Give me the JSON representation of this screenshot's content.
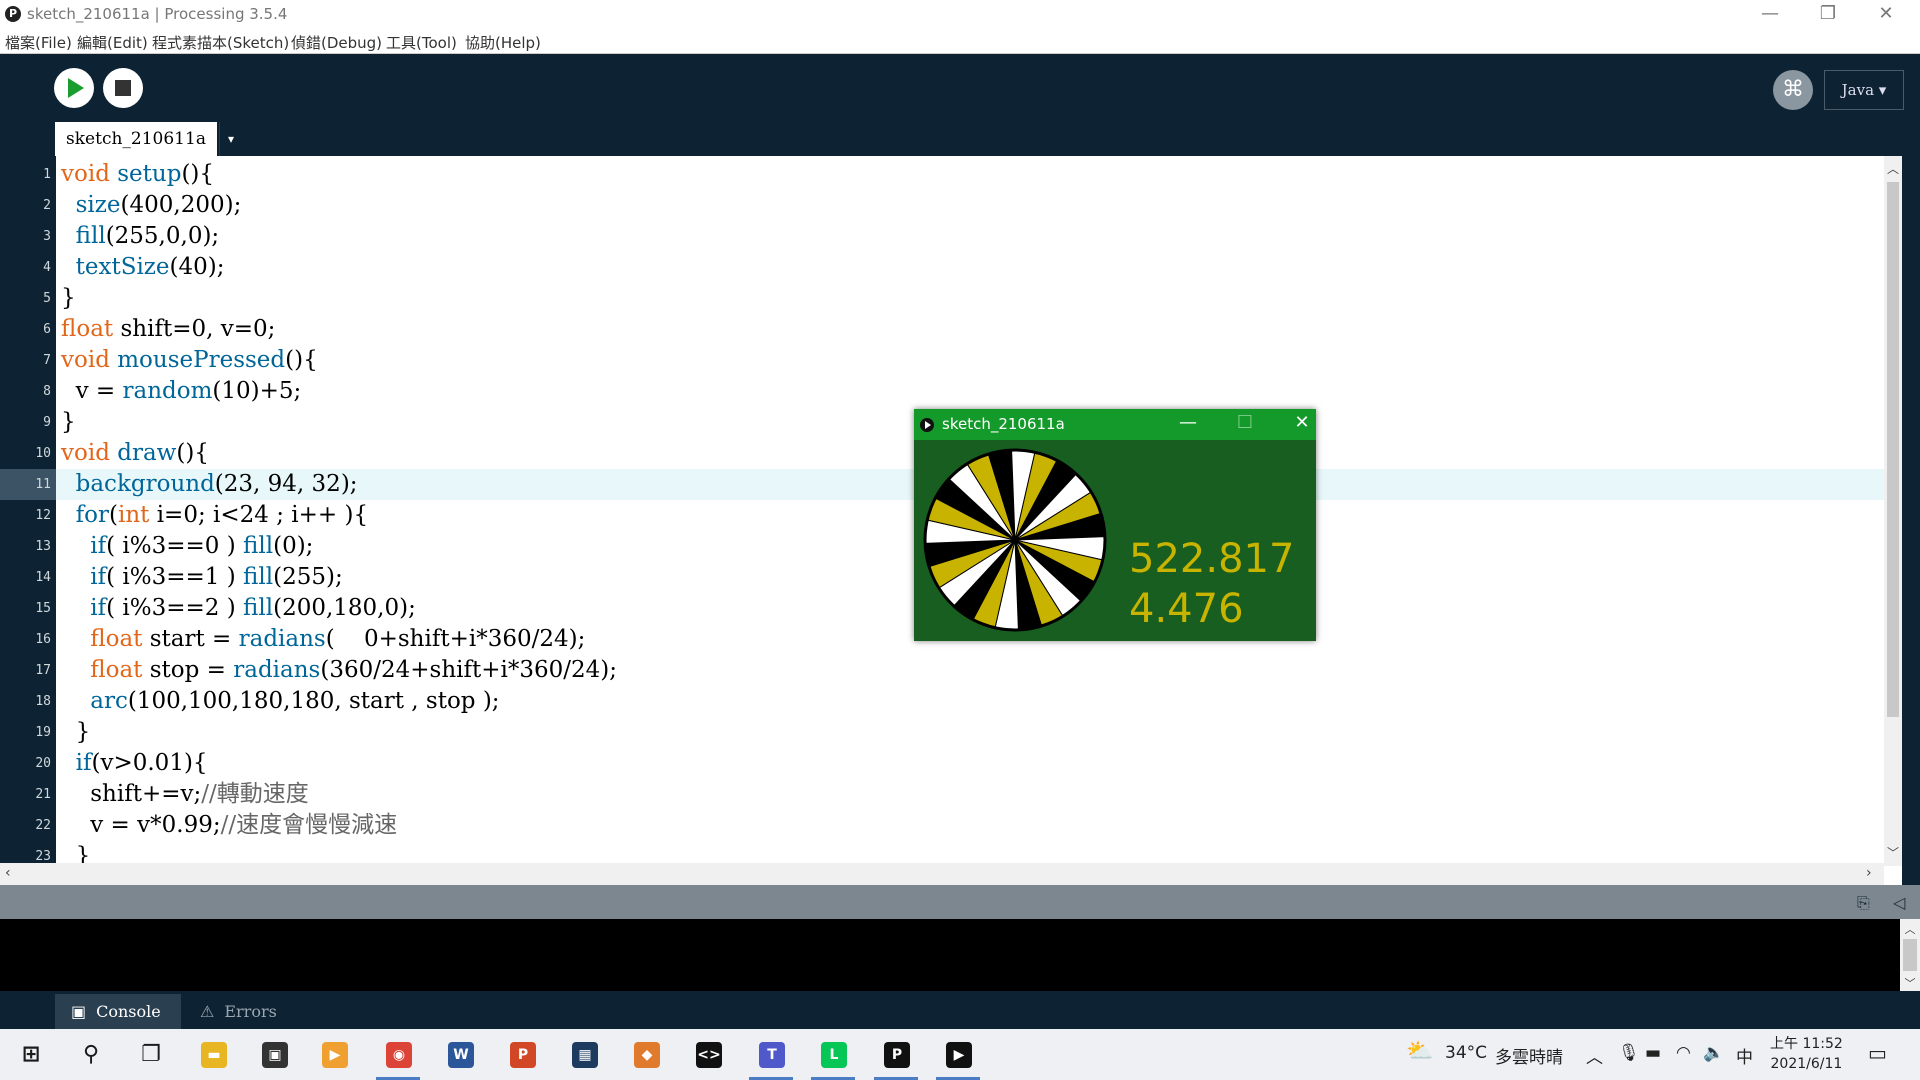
{
  "window": {
    "title": "sketch_210611a | Processing 3.5.4",
    "app_icon_glyph": "P",
    "controls": [
      "minimize-icon",
      "restore-icon",
      "close-icon"
    ]
  },
  "menu": {
    "items": [
      "檔案(File)",
      "編輯(Edit)",
      "程式素描本(Sketch)",
      "偵錯(Debug)",
      "工具(Tool)",
      "協助(Help)"
    ]
  },
  "toolbar": {
    "run_icon": "play-icon",
    "stop_icon": "stop-icon",
    "debugger_icon": "butterfly-icon",
    "mode_label": "Java ▾"
  },
  "tab": {
    "name": "sketch_210611a",
    "menu_arrow": "▾"
  },
  "editor": {
    "current_line": 11,
    "line_numbers": [
      "1",
      "2",
      "3",
      "4",
      "5",
      "6",
      "7",
      "8",
      "9",
      "10",
      "11",
      "12",
      "13",
      "14",
      "15",
      "16",
      "17",
      "18",
      "19",
      "20",
      "21",
      "22",
      "23"
    ],
    "lines": [
      [
        {
          "t": "void",
          "c": "kw"
        },
        {
          "t": " "
        },
        {
          "t": "setup",
          "c": "fn"
        },
        {
          "t": "(){"
        }
      ],
      [
        {
          "t": "  "
        },
        {
          "t": "size",
          "c": "fn"
        },
        {
          "t": "(400,200);"
        }
      ],
      [
        {
          "t": "  "
        },
        {
          "t": "fill",
          "c": "fn"
        },
        {
          "t": "(255,0,0);"
        }
      ],
      [
        {
          "t": "  "
        },
        {
          "t": "textSize",
          "c": "fn"
        },
        {
          "t": "(40);"
        }
      ],
      [
        {
          "t": "}"
        }
      ],
      [
        {
          "t": "float",
          "c": "kw"
        },
        {
          "t": " shift=0, v=0;"
        }
      ],
      [
        {
          "t": "void",
          "c": "kw"
        },
        {
          "t": " "
        },
        {
          "t": "mousePressed",
          "c": "fn"
        },
        {
          "t": "(){"
        }
      ],
      [
        {
          "t": "  v = "
        },
        {
          "t": "random",
          "c": "fn"
        },
        {
          "t": "(10)+5;"
        }
      ],
      [
        {
          "t": "}"
        }
      ],
      [
        {
          "t": "void",
          "c": "kw"
        },
        {
          "t": " "
        },
        {
          "t": "draw",
          "c": "fn"
        },
        {
          "t": "(){"
        }
      ],
      [
        {
          "t": "  "
        },
        {
          "t": "background",
          "c": "fn"
        },
        {
          "t": "(23, 94, 32);"
        }
      ],
      [
        {
          "t": "  "
        },
        {
          "t": "for",
          "c": "fn"
        },
        {
          "t": "("
        },
        {
          "t": "int",
          "c": "kw"
        },
        {
          "t": " i=0; i<24 ; i++ ){"
        }
      ],
      [
        {
          "t": "    "
        },
        {
          "t": "if",
          "c": "fn"
        },
        {
          "t": "( i%3==0 ) "
        },
        {
          "t": "fill",
          "c": "fn"
        },
        {
          "t": "(0);"
        }
      ],
      [
        {
          "t": "    "
        },
        {
          "t": "if",
          "c": "fn"
        },
        {
          "t": "( i%3==1 ) "
        },
        {
          "t": "fill",
          "c": "fn"
        },
        {
          "t": "(255);"
        }
      ],
      [
        {
          "t": "    "
        },
        {
          "t": "if",
          "c": "fn"
        },
        {
          "t": "( i%3==2 ) "
        },
        {
          "t": "fill",
          "c": "fn"
        },
        {
          "t": "(200,180,0);"
        }
      ],
      [
        {
          "t": "    "
        },
        {
          "t": "float",
          "c": "kw"
        },
        {
          "t": " start = "
        },
        {
          "t": "radians",
          "c": "fn"
        },
        {
          "t": "(    0+shift+i*360/24);"
        }
      ],
      [
        {
          "t": "    "
        },
        {
          "t": "float",
          "c": "kw"
        },
        {
          "t": " stop = "
        },
        {
          "t": "radians",
          "c": "fn"
        },
        {
          "t": "(360/24+shift+i*360/24);"
        }
      ],
      [
        {
          "t": "    "
        },
        {
          "t": "arc",
          "c": "fn"
        },
        {
          "t": "(100,100,180,180, start , stop );"
        }
      ],
      [
        {
          "t": "  }"
        }
      ],
      [
        {
          "t": "  "
        },
        {
          "t": "if",
          "c": "fn"
        },
        {
          "t": "(v>0.01){"
        }
      ],
      [
        {
          "t": "    shift+=v;"
        },
        {
          "t": "//轉動速度",
          "c": "cm"
        }
      ],
      [
        {
          "t": "    v = v*0.99;"
        },
        {
          "t": "//速度會慢慢減速",
          "c": "cm"
        }
      ],
      [
        {
          "t": "  }"
        }
      ]
    ]
  },
  "console": {
    "tabs": [
      {
        "label": "Console",
        "icon": "terminal-icon",
        "active": true
      },
      {
        "label": "Errors",
        "icon": "warning-icon",
        "active": false
      }
    ],
    "output": ""
  },
  "sketch_window": {
    "title": "sketch_210611a",
    "background": "#175e20",
    "wheel_colors": [
      "#000000",
      "#ffffff",
      "#c8b400"
    ],
    "wheel_slices": 24,
    "text_color": "#c8b400",
    "shift_value": "522.817",
    "v_value": "4.476"
  },
  "taskbar": {
    "apps": [
      {
        "name": "windows-start-icon",
        "glyph": "⊞",
        "color": "#1b1b1b",
        "running": false
      },
      {
        "name": "search-icon",
        "glyph": "⚲",
        "color": "#1b1b1b",
        "running": false
      },
      {
        "name": "task-view-icon",
        "glyph": "❐",
        "color": "#1b1b1b",
        "running": false
      },
      {
        "name": "file-explorer-icon",
        "glyph": "▬",
        "color": "#e8b623",
        "running": false
      },
      {
        "name": "store-icon",
        "glyph": "▣",
        "color": "#333333",
        "running": false
      },
      {
        "name": "media-player-icon",
        "glyph": "▶",
        "color": "#f0a030",
        "running": false
      },
      {
        "name": "chrome-icon",
        "glyph": "◉",
        "color": "#db4437",
        "running": true
      },
      {
        "name": "word-icon",
        "glyph": "W",
        "color": "#2b579a",
        "running": false
      },
      {
        "name": "powerpoint-icon",
        "glyph": "P",
        "color": "#d24726",
        "running": false
      },
      {
        "name": "app-grid-icon",
        "glyph": "▦",
        "color": "#1d3b5e",
        "running": false
      },
      {
        "name": "app-diamond-icon",
        "glyph": "◆",
        "color": "#e07a2c",
        "running": false
      },
      {
        "name": "code-app-icon",
        "glyph": "<>",
        "color": "#111111",
        "running": false
      },
      {
        "name": "teams-icon",
        "glyph": "T",
        "color": "#5059c9",
        "running": true
      },
      {
        "name": "line-icon",
        "glyph": "L",
        "color": "#06c755",
        "running": true
      },
      {
        "name": "processing-icon",
        "glyph": "P",
        "color": "#111111",
        "running": true
      },
      {
        "name": "sketch-run-icon",
        "glyph": "▶",
        "color": "#111111",
        "running": true
      }
    ],
    "weather": {
      "icon": "cloud-sun-icon",
      "temp": "34°C",
      "desc": "多雲時晴"
    },
    "tray_icons": [
      "chevron-up-icon",
      "microphone-icon",
      "battery-icon",
      "wifi-icon",
      "speaker-icon"
    ],
    "ime": "中",
    "time": "上午 11:52",
    "date": "2021/6/11",
    "notification_icon": "notification-icon"
  }
}
